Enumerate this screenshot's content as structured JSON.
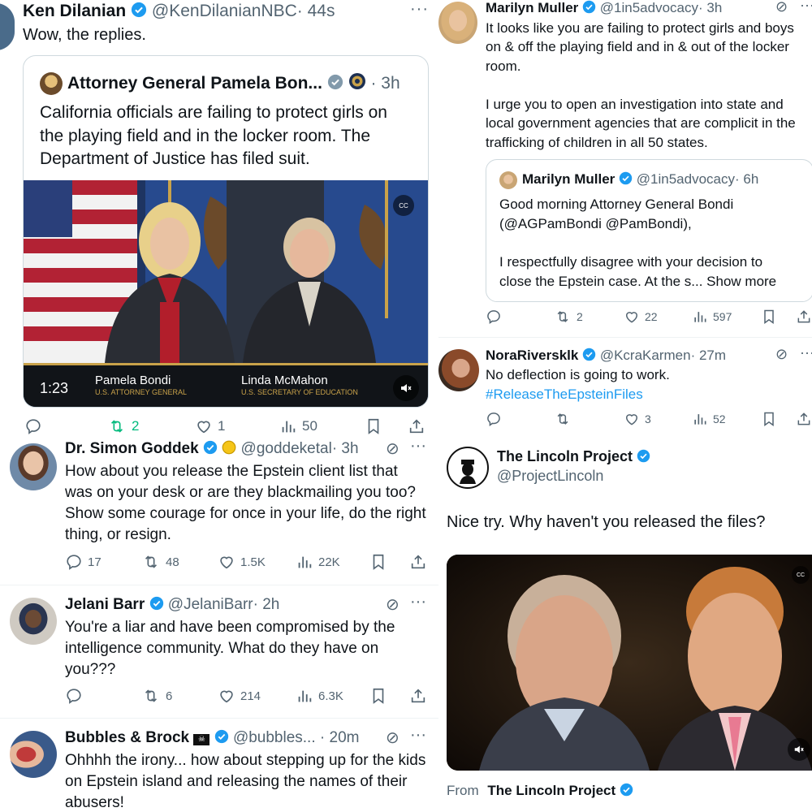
{
  "colors": {
    "accent": "#1d9bf0",
    "text": "#0f1419",
    "muted": "#536471",
    "retweet_active": "#00ba7c",
    "verified": "#1d9bf0"
  },
  "tl": {
    "name": "Ken Dilanian",
    "handle": "@KenDilanianNBC",
    "time": "· 44s",
    "text": "Wow, the replies.",
    "quote": {
      "name": "Attorney General Pamela Bon...",
      "time": "· 3h",
      "text": "California officials are failing to protect girls on the playing field and in the locker room. The Department of Justice has filed suit.",
      "video": {
        "duration": "1:23",
        "person1_name": "Pamela Bondi",
        "person1_title": "U.S. ATTORNEY GENERAL",
        "person2_name": "Linda McMahon",
        "person2_title": "U.S. SECRETARY OF EDUCATION"
      }
    },
    "stats": {
      "replies": "",
      "retweets": "2",
      "likes": "1",
      "views": "50"
    }
  },
  "tr": {
    "tweet1": {
      "name": "Marilyn Muller",
      "handle": "@1in5advocacy",
      "time": "· 3h",
      "para1": "It looks like you are failing to protect girls and boys on & off the playing field and in & out of the locker room.",
      "para2": "I urge you to open an investigation into state and local government agencies that are complicit in the trafficking of children in all 50 states.",
      "quote": {
        "name": "Marilyn Muller",
        "handle": "@1in5advocacy",
        "time": "· 6h",
        "line1": "Good morning Attorney General Bondi",
        "line2": "(@AGPamBondi @PamBondi),",
        "line3": "I respectfully disagree with your decision to",
        "line4": "close the Epstein case. At the s...",
        "show_more": "Show more"
      },
      "stats": {
        "replies": "",
        "retweets": "2",
        "likes": "22",
        "views": "597"
      }
    },
    "tweet2": {
      "name": "NoraRiversklk",
      "handle": "@KcraKarmen",
      "time": "· 27m",
      "text": "No deflection is going to work.",
      "hashtag": "#ReleaseTheEpsteinFiles",
      "stats": {
        "replies": "",
        "retweets": "",
        "likes": "3",
        "views": "52"
      }
    }
  },
  "bl": {
    "tweets": [
      {
        "name": "Dr. Simon Goddek",
        "handle": "@goddeketal",
        "time": "· 3h",
        "text": "How about you release the Epstein client list that was on your desk or are they blackmailing you too? Show some courage for once in your life, do the right thing, or resign.",
        "stats": {
          "replies": "17",
          "retweets": "48",
          "likes": "1.5K",
          "views": "22K"
        }
      },
      {
        "name": "Jelani Barr",
        "handle": "@JelaniBarr",
        "time": "· 2h",
        "text": "You're a liar and have been compromised by the intelligence community. What do they have on you???",
        "stats": {
          "replies": "",
          "retweets": "6",
          "likes": "214",
          "views": "6.3K"
        }
      },
      {
        "name": "Bubbles & Brock",
        "handle": "@bubbles...",
        "time": "· 20m",
        "text": "Ohhhh the irony... how about stepping up for the kids on Epstein island and releasing the names of their abusers!"
      }
    ]
  },
  "br": {
    "name": "The Lincoln Project",
    "handle": "@ProjectLincoln",
    "text": "Nice try. Why haven't you released the files?",
    "from_label": "From",
    "from_name": "The Lincoln Project"
  }
}
